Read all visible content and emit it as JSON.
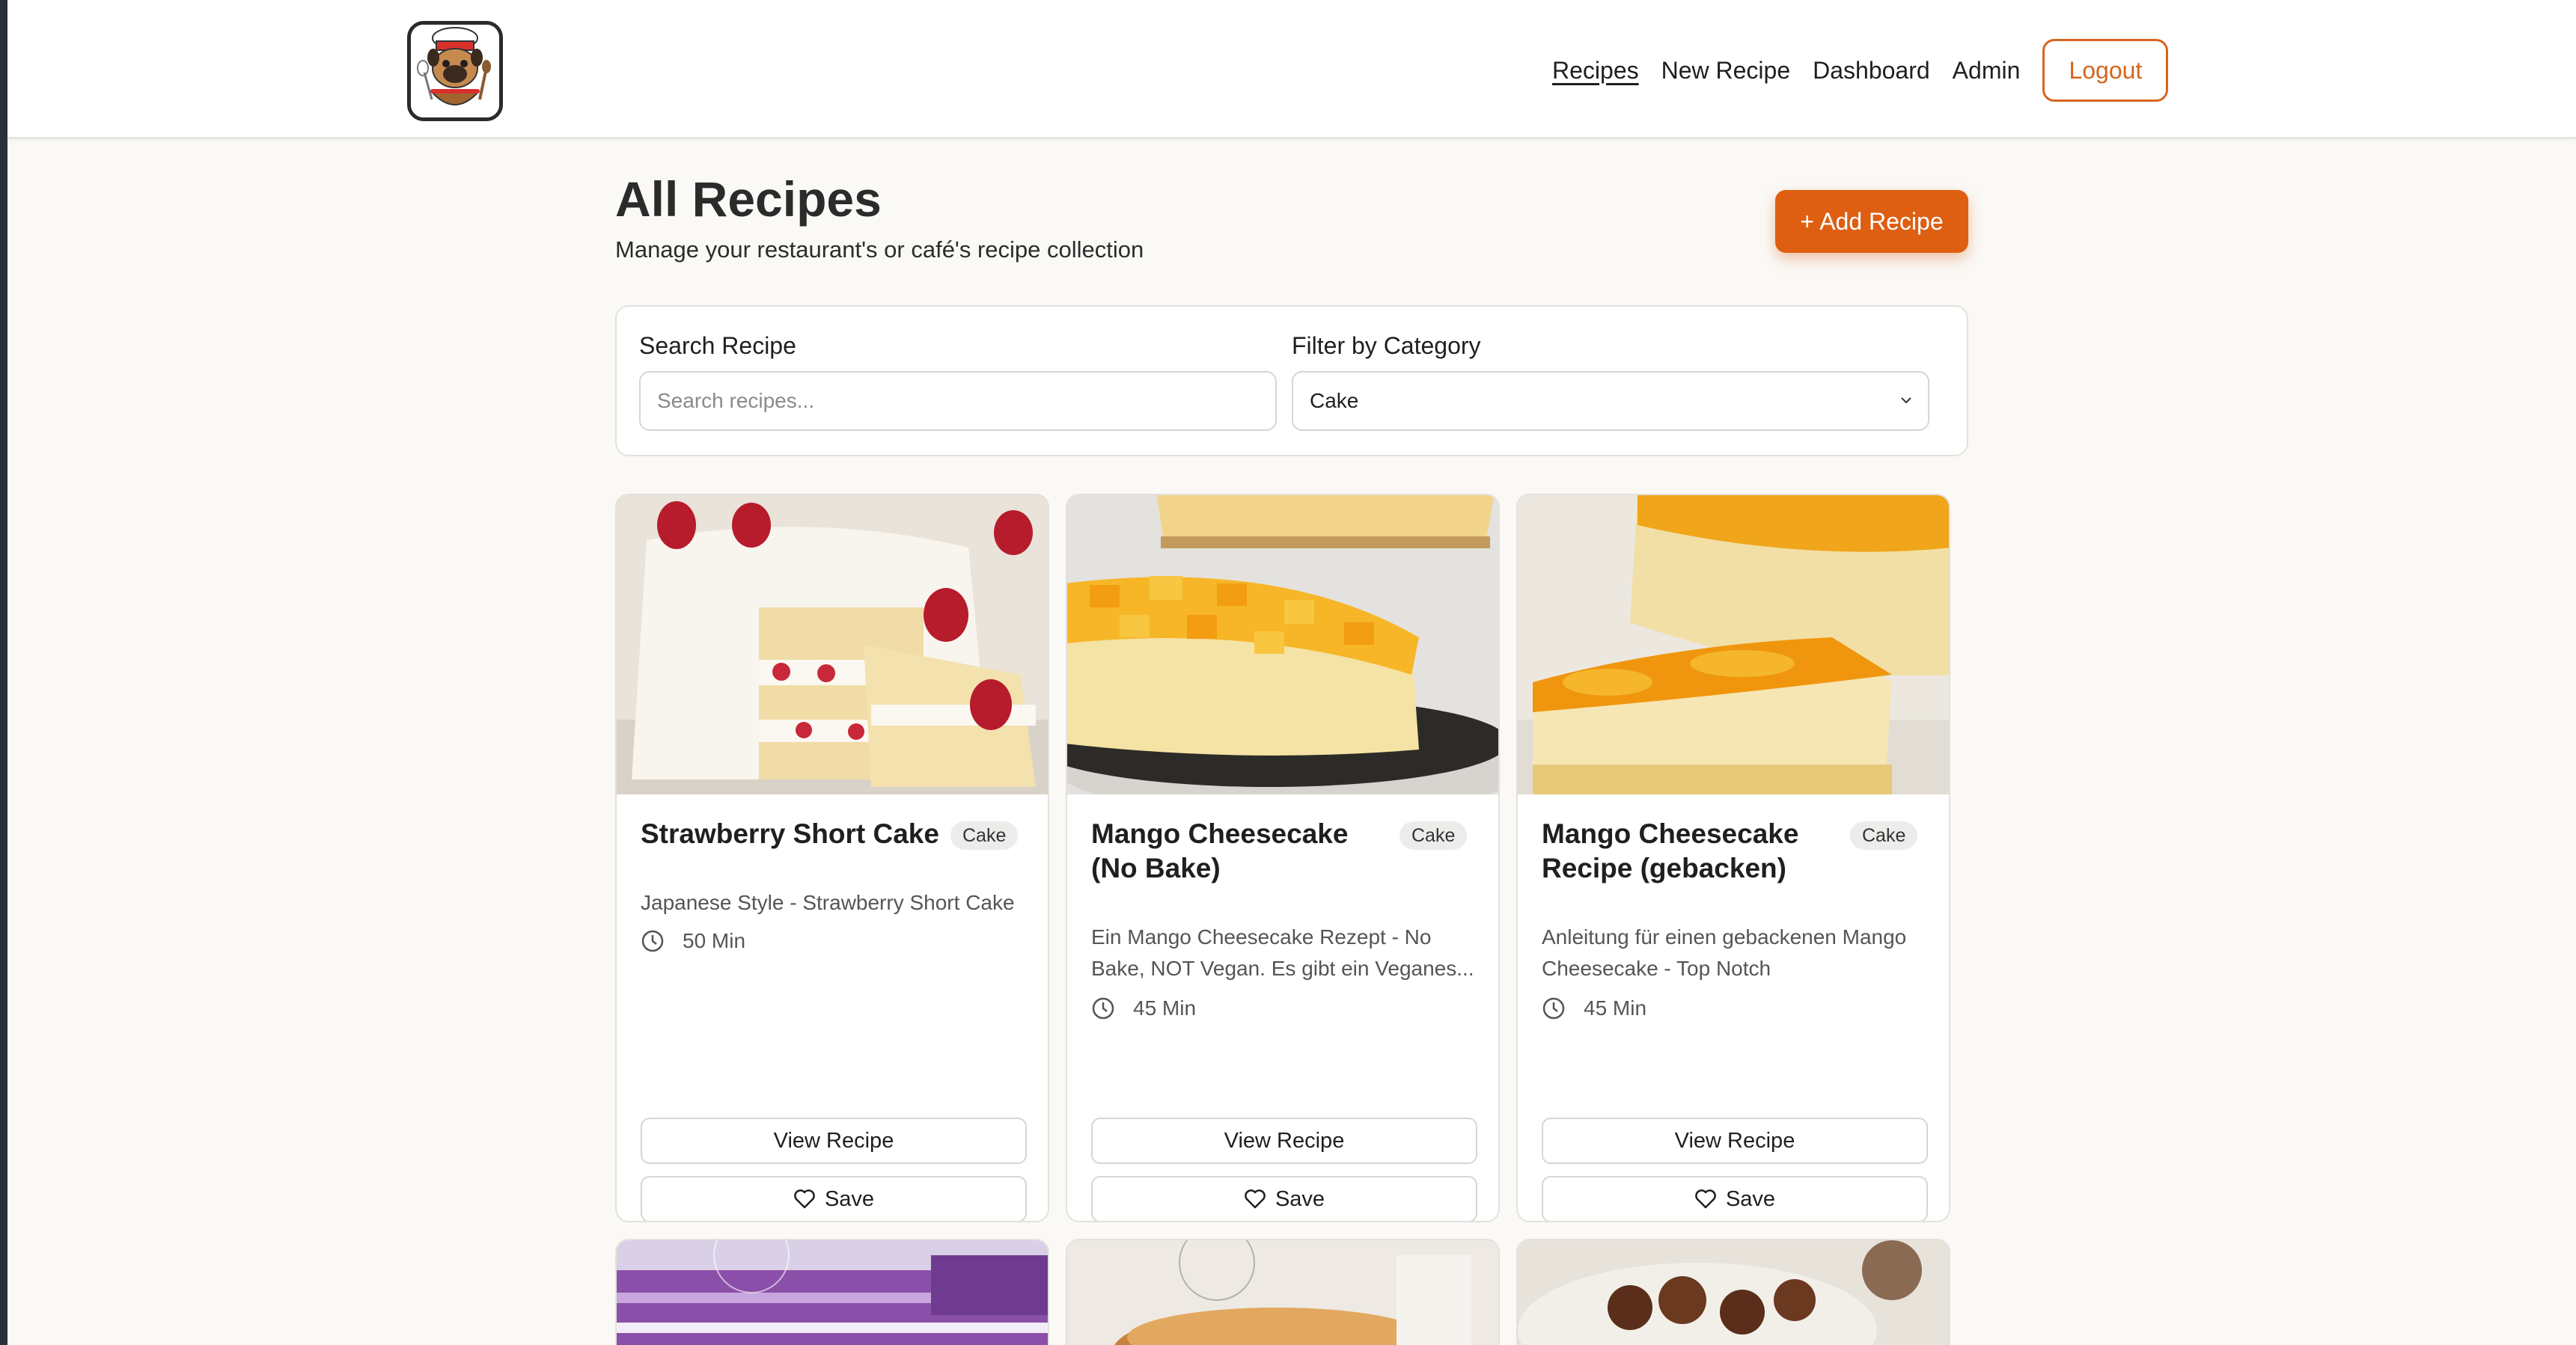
{
  "nav": {
    "items": [
      {
        "label": "Recipes",
        "active": true
      },
      {
        "label": "New Recipe",
        "active": false
      },
      {
        "label": "Dashboard",
        "active": false
      },
      {
        "label": "Admin",
        "active": false
      }
    ],
    "logout_label": "Logout",
    "logo_icon": "chef-pug-logo"
  },
  "header": {
    "title": "All Recipes",
    "subtitle": "Manage your restaurant's or café's recipe collection",
    "add_label": "+ Add Recipe"
  },
  "filters": {
    "search_label": "Search Recipe",
    "search_placeholder": "Search recipes...",
    "search_value": "",
    "category_label": "Filter by Category",
    "category_value": "Cake"
  },
  "cards": [
    {
      "title": "Strawberry Short Cake",
      "category": "Cake",
      "description": "Japanese Style - Strawberry Short Cake",
      "time": "50 Min",
      "view_label": "View Recipe",
      "save_label": "Save"
    },
    {
      "title": "Mango Cheesecake (No Bake)",
      "category": "Cake",
      "description": "Ein Mango Cheesecake Rezept - No Bake, NOT Vegan. Es gibt ein Veganes...",
      "time": "45 Min",
      "view_label": "View Recipe",
      "save_label": "Save"
    },
    {
      "title": "Mango Cheesecake Recipe (gebacken)",
      "category": "Cake",
      "description": "Anleitung für einen gebackenen Mango Cheesecake - Top Notch",
      "time": "45 Min",
      "view_label": "View Recipe",
      "save_label": "Save"
    }
  ],
  "colors": {
    "accent": "#de5f12",
    "background": "#faf9f6"
  }
}
